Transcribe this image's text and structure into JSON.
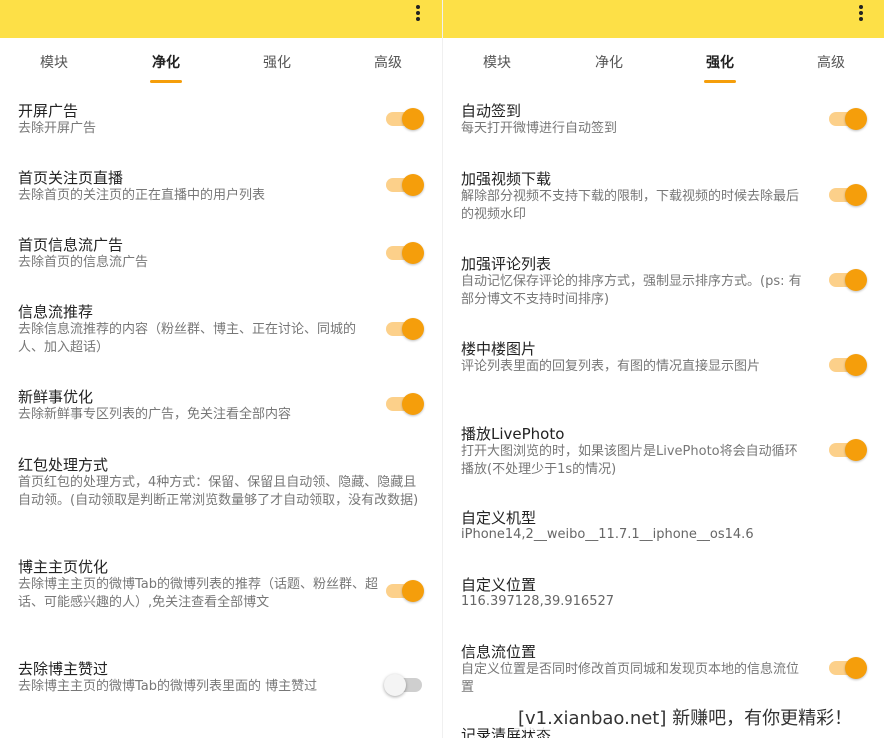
{
  "colors": {
    "appbar": "#fde047",
    "accent": "#f59e0b",
    "track_on": "#fcd08a",
    "track_off": "#cfcfcf"
  },
  "left": {
    "menu_icon": "more-vert-icon",
    "tabs": [
      "模块",
      "净化",
      "强化",
      "高级"
    ],
    "active_tab": 1,
    "settings": [
      {
        "title": "开屏广告",
        "desc": "去除开屏广告",
        "on": true
      },
      {
        "title": "首页关注页直播",
        "desc": "去除首页的关注页的正在直播中的用户列表",
        "on": true
      },
      {
        "title": "首页信息流广告",
        "desc": "去除首页的信息流广告",
        "on": true
      },
      {
        "title": "信息流推荐",
        "desc": "去除信息流推荐的内容（粉丝群、博主、正在讨论、同城的人、加入超话）",
        "on": true
      },
      {
        "title": "新鲜事优化",
        "desc": "去除新鲜事专区列表的广告，免关注看全部内容",
        "on": true
      },
      {
        "title": "红包处理方式",
        "desc": "首页红包的处理方式，4种方式：保留、保留且自动领、隐藏、隐藏且自动领。(自动领取是判断正常浏览数量够了才自动领取，没有改数据)"
      },
      {
        "title": "博主主页优化",
        "desc": "去除博主主页的微博Tab的微博列表的推荐（话题、粉丝群、超话、可能感兴趣的人）,免关注查看全部博文",
        "on": true
      },
      {
        "title": "去除博主赞过",
        "desc": "去除博主主页的微博Tab的微博列表里面的 博主赞过",
        "on": false
      }
    ]
  },
  "right": {
    "menu_icon": "more-vert-icon",
    "tabs": [
      "模块",
      "净化",
      "强化",
      "高级"
    ],
    "active_tab": 2,
    "settings": [
      {
        "title": "自动签到",
        "desc": "每天打开微博进行自动签到",
        "on": true
      },
      {
        "title": "加强视频下载",
        "desc": "解除部分视频不支持下载的限制，下载视频的时候去除最后的视频水印",
        "on": true
      },
      {
        "title": "加强评论列表",
        "desc": "自动记忆保存评论的排序方式，强制显示排序方式。(ps: 有部分博文不支持时间排序)",
        "on": true
      },
      {
        "title": "楼中楼图片",
        "desc": "评论列表里面的回复列表，有图的情况直接显示图片",
        "on": true
      },
      {
        "title": "播放LivePhoto",
        "desc": "打开大图浏览的时，如果该图片是LivePhoto将会自动循环播放(不处理少于1s的情况)",
        "on": true
      },
      {
        "title": "自定义机型",
        "value": "iPhone14,2__weibo__11.7.1__iphone__os14.6"
      },
      {
        "title": "自定义位置",
        "value": "116.397128,39.916527"
      },
      {
        "title": "信息流位置",
        "desc": "自定义位置是否同时修改首页同城和发现页本地的信息流位置",
        "on": true
      },
      {
        "title": "记录清屏状态"
      }
    ]
  },
  "watermark": "[v1.xianbao.net] 新赚吧，有你更精彩！"
}
